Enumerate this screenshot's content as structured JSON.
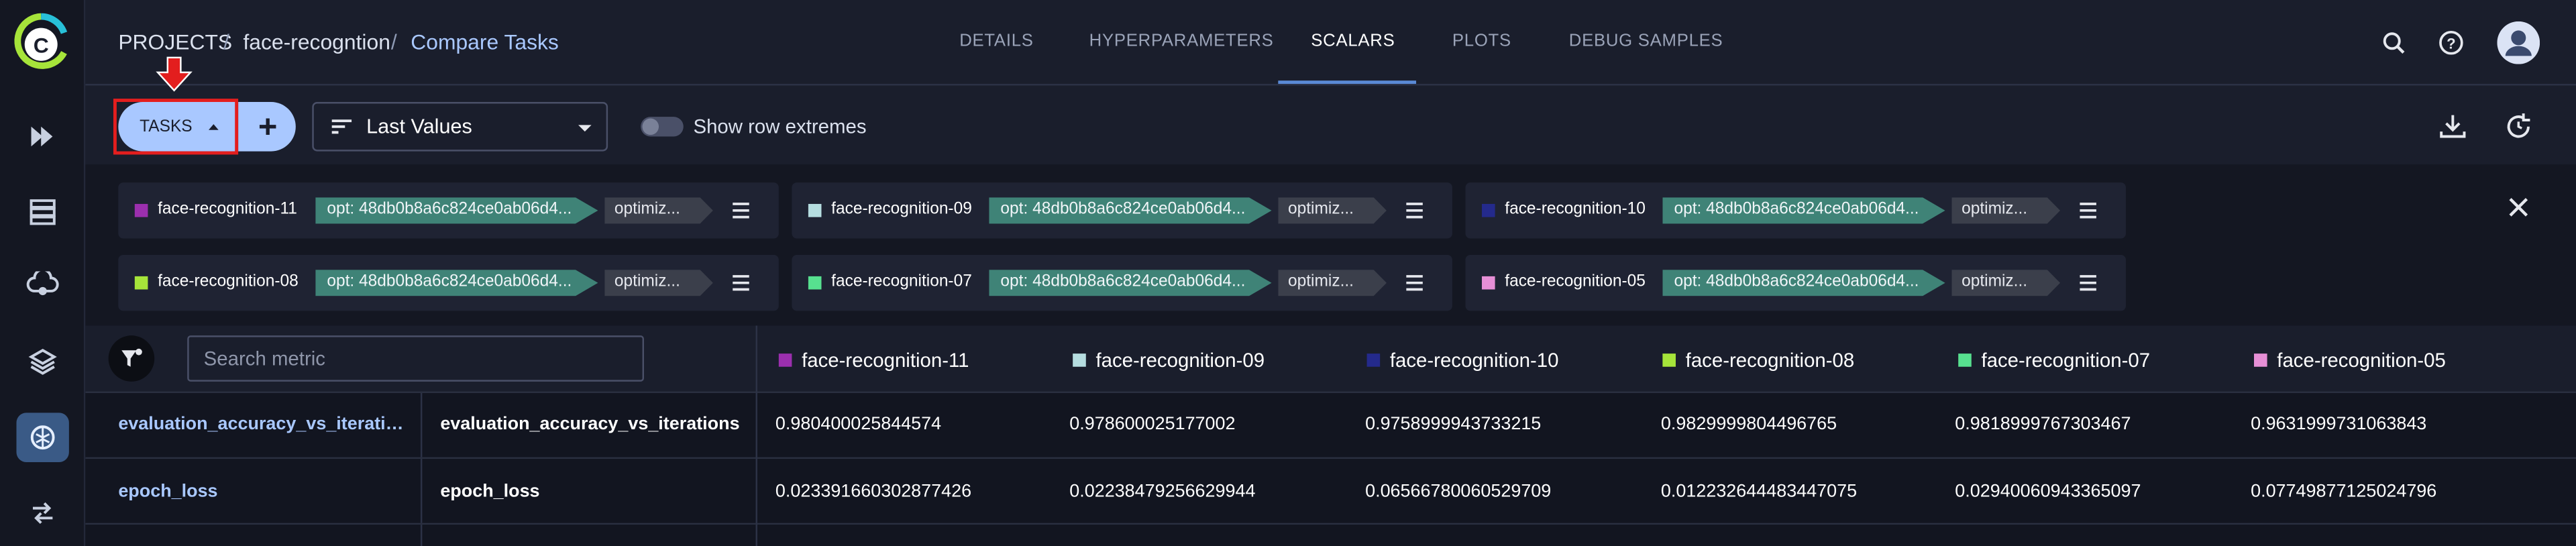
{
  "breadcrumb": {
    "root": "PROJECTS",
    "separator": "/",
    "project": "face-recogntion",
    "current": "Compare Tasks"
  },
  "tabs": [
    {
      "label": "DETAILS",
      "active": false
    },
    {
      "label": "HYPERPARAMETERS",
      "active": false
    },
    {
      "label": "SCALARS",
      "active": true
    },
    {
      "label": "PLOTS",
      "active": false
    },
    {
      "label": "DEBUG SAMPLES",
      "active": false
    }
  ],
  "toolbar": {
    "tasks_label": "TASKS",
    "view_select": "Last Values",
    "toggle_label": "Show row extremes",
    "toggle_on": false
  },
  "tasks": [
    {
      "name": "face-recognition-11",
      "color": "#9b2fae",
      "opt": "opt: 48db0b8a6c824ce0ab06d4...",
      "tag": "optimiz..."
    },
    {
      "name": "face-recognition-09",
      "color": "#b5dde0",
      "opt": "opt: 48db0b8a6c824ce0ab06d4...",
      "tag": "optimiz..."
    },
    {
      "name": "face-recognition-10",
      "color": "#242a8c",
      "opt": "opt: 48db0b8a6c824ce0ab06d4...",
      "tag": "optimiz..."
    },
    {
      "name": "face-recognition-08",
      "color": "#a6e43a",
      "opt": "opt: 48db0b8a6c824ce0ab06d4...",
      "tag": "optimiz..."
    },
    {
      "name": "face-recognition-07",
      "color": "#57e08f",
      "opt": "opt: 48db0b8a6c824ce0ab06d4...",
      "tag": "optimiz..."
    },
    {
      "name": "face-recognition-05",
      "color": "#e68fd6",
      "opt": "opt: 48db0b8a6c824ce0ab06d4...",
      "tag": "optimiz..."
    }
  ],
  "table": {
    "search_placeholder": "Search metric",
    "columns": [
      {
        "name": "face-recognition-11",
        "color": "#9b2fae"
      },
      {
        "name": "face-recognition-09",
        "color": "#b5dde0"
      },
      {
        "name": "face-recognition-10",
        "color": "#242a8c"
      },
      {
        "name": "face-recognition-08",
        "color": "#a6e43a"
      },
      {
        "name": "face-recognition-07",
        "color": "#57e08f"
      },
      {
        "name": "face-recognition-05",
        "color": "#e68fd6"
      }
    ],
    "rows": [
      {
        "group": "evaluation_accuracy_vs_iteratio...",
        "metric": "evaluation_accuracy_vs_iterations",
        "values": [
          "0.980400025844574",
          "0.978600025177002",
          "0.9758999943733215",
          "0.9829999804496765",
          "0.9818999767303467",
          "0.9631999731063843"
        ]
      },
      {
        "group": "epoch_loss",
        "metric": "epoch_loss",
        "values": [
          "0.023391660302877426",
          "0.02238479256629944",
          "0.06566780060529709",
          "0.012232644483447075",
          "0.02940060943365097",
          "0.07749877125024796"
        ]
      }
    ]
  },
  "colors": {
    "accent": "#a9c8ff",
    "highlight": "#e31e1e",
    "opt_tag": "#3f8377",
    "active_nav": "#3a5a86"
  }
}
